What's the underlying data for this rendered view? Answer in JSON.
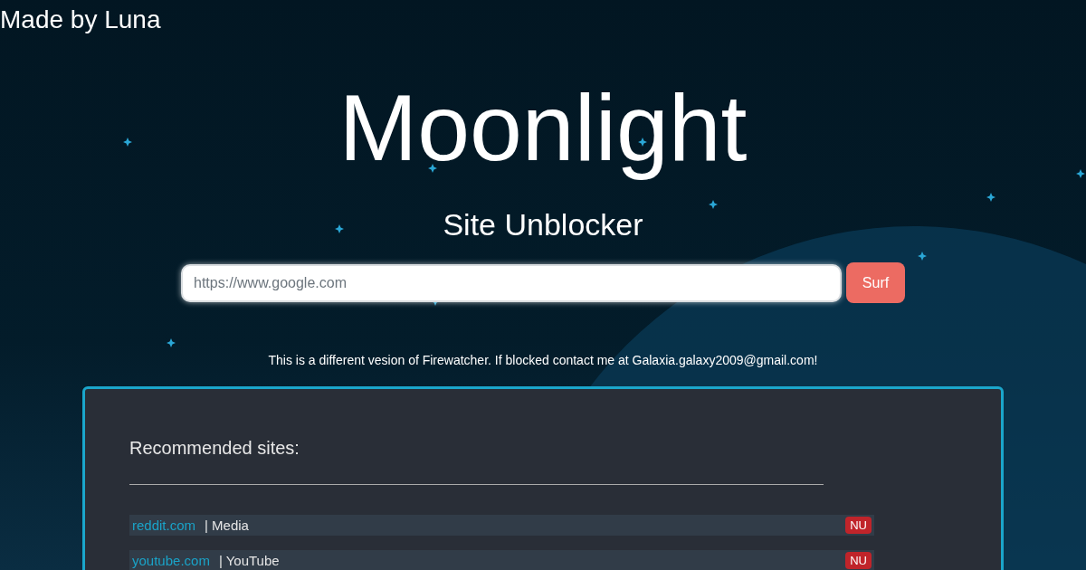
{
  "credit": "Made by Luna",
  "title": "Moonlight",
  "subtitle": "Site Unblocker",
  "search": {
    "placeholder": "https://www.google.com",
    "button": "Surf"
  },
  "notice": "This is a different vesion of Firewatcher. If blocked contact me at Galaxia.galaxy2009@gmail.com!",
  "panel": {
    "heading": "Recommended sites:",
    "sites": [
      {
        "link": "reddit.com",
        "label": "| Media",
        "badge": "NU"
      },
      {
        "link": "youtube.com",
        "label": "| YouTube",
        "badge": "NU"
      }
    ]
  }
}
